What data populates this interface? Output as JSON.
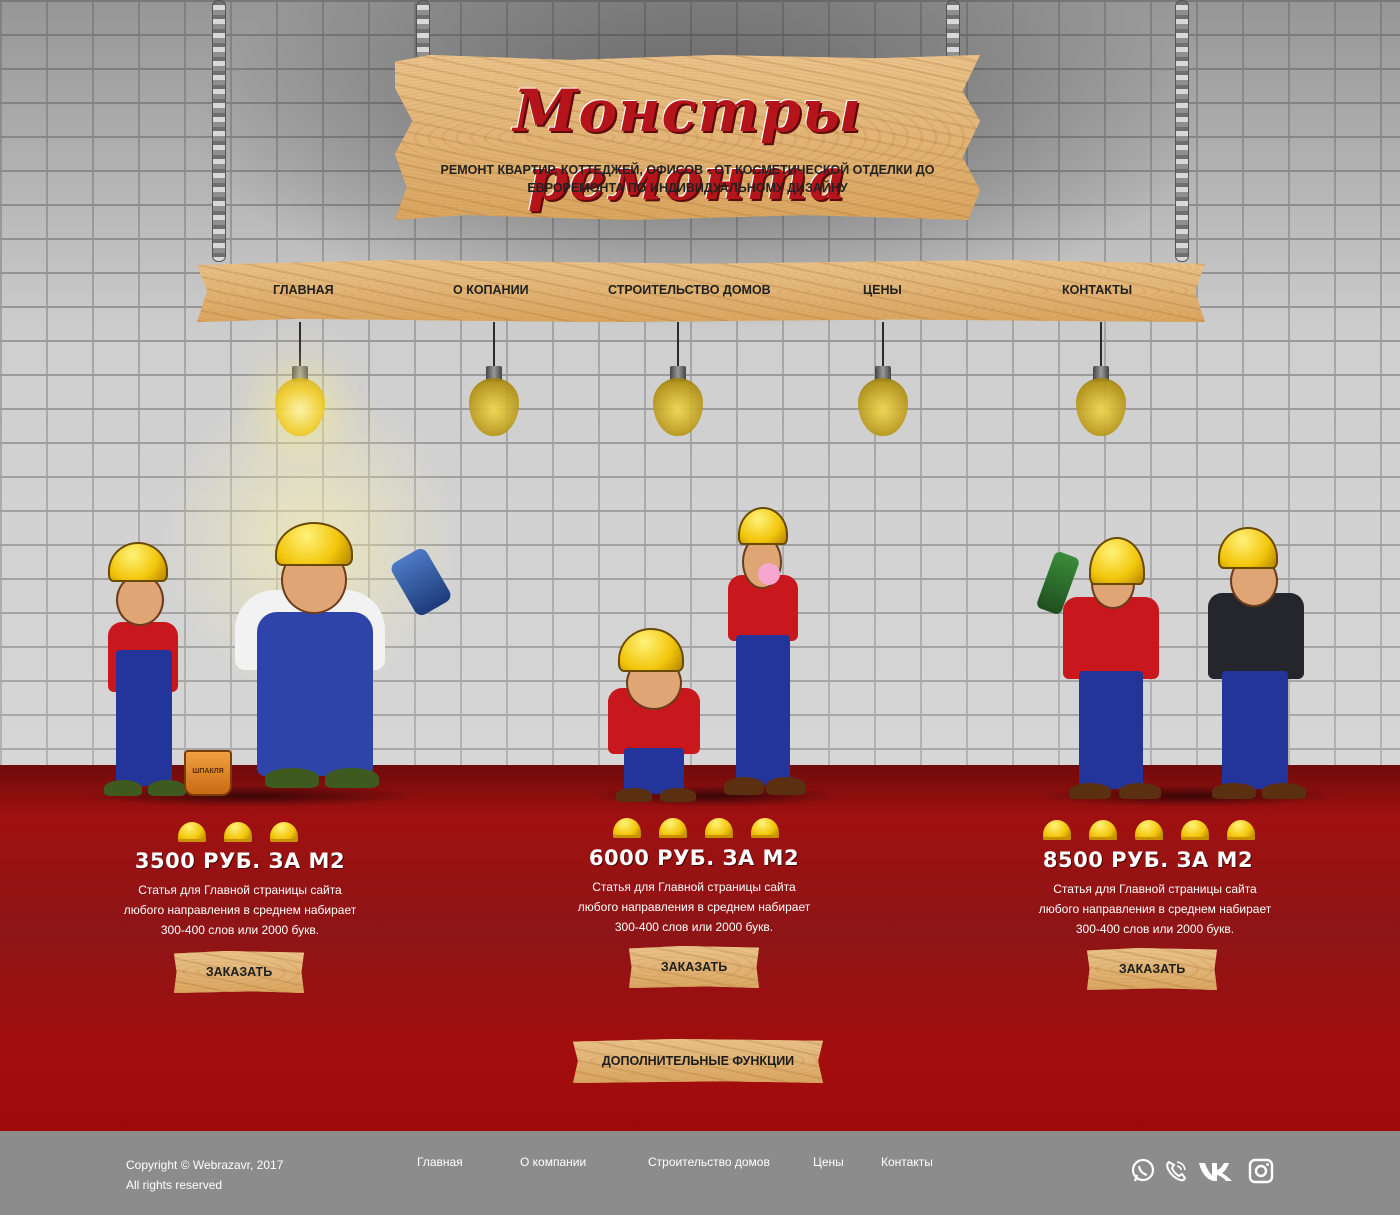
{
  "header": {
    "title": "Монстры ремонта",
    "subtitle_line1": "РЕМОНТ КВАРТИР, КОТТЕДЖЕЙ, ОФИСОВ - ОТ КОСМЕТИЧЕСКОЙ ОТДЕЛКИ ДО",
    "subtitle_line2": "ЕВРОРЕМОНТА ПО ИНДИВИДУАЛЬНОМУ ДИЗАЙНУ"
  },
  "nav": {
    "items": [
      "ГЛАВНАЯ",
      "О КОПАНИИ",
      "СТРОИТЕЛЬСТВО ДОМОВ",
      "ЦЕНЫ",
      "КОНТАКТЫ"
    ]
  },
  "bulbs": {
    "lit_index": 0,
    "count": 5
  },
  "bucket_label": "ШПАКЛЯ",
  "plans": [
    {
      "helmets": 3,
      "price": "3500 РУБ. ЗА М2",
      "desc_lines": [
        "Статья для Главной страницы сайта",
        "любого направления в среднем набирает",
        "300-400 слов или 2000 букв."
      ],
      "button": "ЗАКАЗАТЬ"
    },
    {
      "helmets": 4,
      "price": "6000 РУБ. ЗА М2",
      "desc_lines": [
        "Статья для Главной страницы сайта",
        "любого направления в среднем набирает",
        "300-400 слов или 2000 букв."
      ],
      "button": "ЗАКАЗАТЬ"
    },
    {
      "helmets": 5,
      "price": "8500 РУБ. ЗА М2",
      "desc_lines": [
        "Статья для Главной страницы сайта",
        "любого направления в среднем набирает",
        "300-400 слов или 2000 букв."
      ],
      "button": "ЗАКАЗАТЬ"
    }
  ],
  "extra_button": "ДОПОЛНИТЕЛЬНЫЕ ФУНКЦИИ",
  "footer": {
    "copyright": "Copyright © Webrazavr, 2017",
    "rights": "All rights reserved",
    "links": [
      "Главная",
      "О компании",
      "Строительство домов",
      "Цены",
      "Контакты"
    ],
    "social": [
      "whatsapp-icon",
      "viber-icon",
      "vk-icon",
      "instagram-icon"
    ]
  },
  "colors": {
    "accent_red": "#a01010",
    "title_red": "#b5141b",
    "wood": "#e2b373",
    "helmet_yellow": "#f2c60b",
    "footer_gray": "#8c8c8c"
  }
}
